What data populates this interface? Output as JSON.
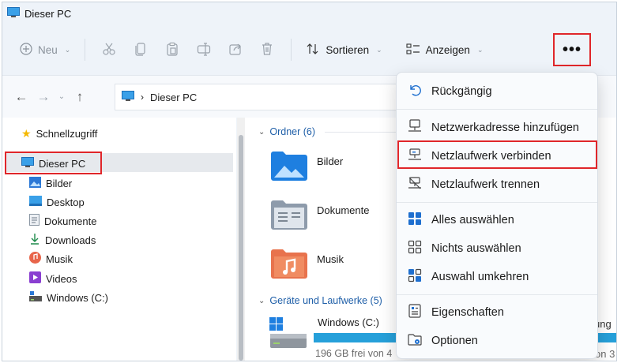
{
  "window": {
    "title": "Dieser PC"
  },
  "toolbar": {
    "new_label": "Neu",
    "sort_label": "Sortieren",
    "view_label": "Anzeigen",
    "more_label": "•••"
  },
  "address": {
    "crumb": "Dieser PC"
  },
  "sidebar": {
    "items": [
      {
        "label": "Schnellzugriff"
      },
      {
        "label": "Dieser PC"
      },
      {
        "label": "Bilder"
      },
      {
        "label": "Desktop"
      },
      {
        "label": "Dokumente"
      },
      {
        "label": "Downloads"
      },
      {
        "label": "Musik"
      },
      {
        "label": "Videos"
      },
      {
        "label": "Windows (C:)"
      }
    ]
  },
  "content": {
    "folders_header": "Ordner (6)",
    "folders": [
      {
        "name": "Bilder"
      },
      {
        "name": "Dokumente"
      },
      {
        "name": "Musik"
      }
    ],
    "devices_header": "Geräte und Laufwerke (5)",
    "drive": {
      "name": "Windows (C:)",
      "free": "196 GB frei von 4",
      "used_fraction": 0.55
    },
    "peek_right_1": "ung",
    "peek_right_2": "i von 3"
  },
  "menu": {
    "items": [
      {
        "label": "Rückgängig"
      },
      {
        "label": "Netzwerkadresse hinzufügen"
      },
      {
        "label": "Netzlaufwerk verbinden"
      },
      {
        "label": "Netzlaufwerk trennen"
      },
      {
        "label": "Alles auswählen"
      },
      {
        "label": "Nichts auswählen"
      },
      {
        "label": "Auswahl umkehren"
      },
      {
        "label": "Eigenschaften"
      },
      {
        "label": "Optionen"
      }
    ]
  },
  "colors": {
    "accent": "#1f5fa8",
    "highlight": "#e0262a",
    "drive_bar": "#26a0da"
  }
}
